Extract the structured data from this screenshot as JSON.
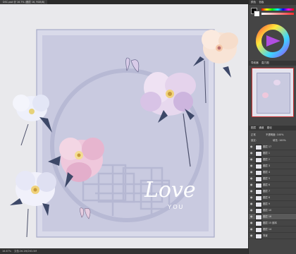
{
  "document": {
    "tab_title": "DSC.psd @ 16.7% (图层 16, RGB/8)",
    "close_glyph": "×",
    "artwork_text": {
      "main": "Love",
      "sub": "YOU"
    }
  },
  "status_bar": {
    "zoom": "16.67%",
    "doc_size": "文档:26.2M/263.5M"
  },
  "panels": {
    "color_tabs": [
      "颜色",
      "色板"
    ],
    "navigator_tabs": [
      "导航器",
      "直方图"
    ],
    "layers_header": [
      "图层",
      "通道",
      "路径"
    ],
    "mode": "正常",
    "opacity_label": "不透明度: 100%",
    "lock_label": "锁定:",
    "fill_label": "填充: 100%",
    "layers": [
      {
        "name": "图层 17",
        "selected": false
      },
      {
        "name": "图层 1",
        "selected": false
      },
      {
        "name": "图层 2",
        "selected": false
      },
      {
        "name": "图层 3",
        "selected": false
      },
      {
        "name": "图层 4",
        "selected": false
      },
      {
        "name": "图层 5",
        "selected": false
      },
      {
        "name": "图层 6",
        "selected": false
      },
      {
        "name": "图层 7",
        "selected": false
      },
      {
        "name": "图层 8",
        "selected": false
      },
      {
        "name": "图层 9",
        "selected": false
      },
      {
        "name": "图层 10",
        "selected": false
      },
      {
        "name": "图层 16",
        "selected": true
      },
      {
        "name": "图层 15 副本",
        "selected": false
      },
      {
        "name": "图层 14",
        "selected": false
      },
      {
        "name": "背景",
        "selected": false
      }
    ]
  },
  "colors": {
    "canvas_bg": "#e9e9ec",
    "card_bg": "#c8c9df",
    "card_frame": "#9da0bd",
    "accent_selected": "#5a5a5a"
  }
}
